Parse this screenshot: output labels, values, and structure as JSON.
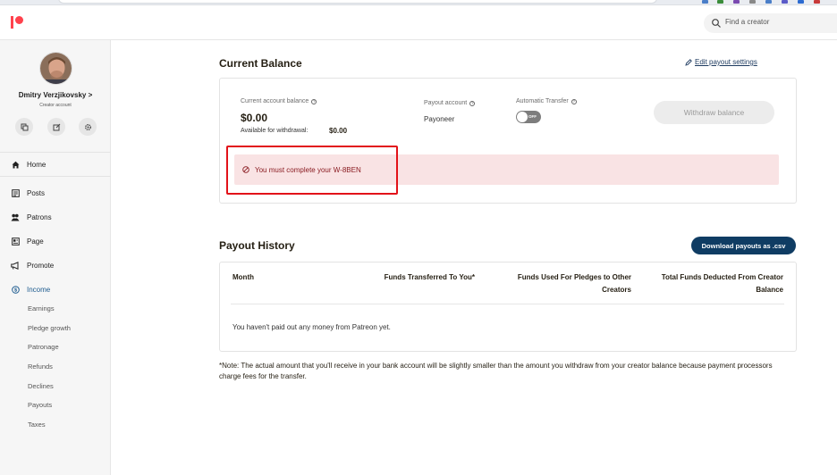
{
  "header": {
    "search_placeholder": "Find a creator"
  },
  "sidebar": {
    "creator_name": "Dmitry Verzjikovsky >",
    "creator_role": "Creator account",
    "nav": [
      {
        "label": "Home",
        "icon": "home-icon"
      },
      {
        "label": "Posts",
        "icon": "posts-icon"
      },
      {
        "label": "Patrons",
        "icon": "patrons-icon"
      },
      {
        "label": "Page",
        "icon": "page-icon"
      },
      {
        "label": "Promote",
        "icon": "promote-icon"
      },
      {
        "label": "Income",
        "icon": "income-icon",
        "active": true
      }
    ],
    "income_sub": [
      "Earnings",
      "Pledge growth",
      "Patronage",
      "Refunds",
      "Declines",
      "Payouts",
      "Taxes"
    ]
  },
  "balance": {
    "title": "Current Balance",
    "edit_link": "Edit payout settings",
    "current_label": "Current account balance",
    "current_value": "$0.00",
    "available_label": "Available for withdrawal:",
    "available_value": "$0.00",
    "payout_label": "Payout account",
    "payout_value": "Payoneer",
    "auto_label": "Automatic Transfer",
    "toggle_state": "OFF",
    "withdraw_label": "Withdraw balance",
    "alert_text": "You must complete your W-8BEN"
  },
  "history": {
    "title": "Payout History",
    "download_label": "Download payouts as .csv",
    "columns": [
      "Month",
      "Funds Transferred To You*",
      "Funds Used For Pledges to Other Creators",
      "Total Funds Deducted From Creator Balance"
    ],
    "empty_text": "You haven't paid out any money from Patreon yet."
  },
  "note": "*Note: The actual amount that you'll receive in your bank account will be slightly smaller than the amount you withdraw from your creator balance because payment processors charge fees for the transfer.",
  "colors": {
    "brand": "#ff424d",
    "accent": "#0f3c63",
    "alert_bg": "#f9e3e4",
    "highlight": "#e21219"
  }
}
